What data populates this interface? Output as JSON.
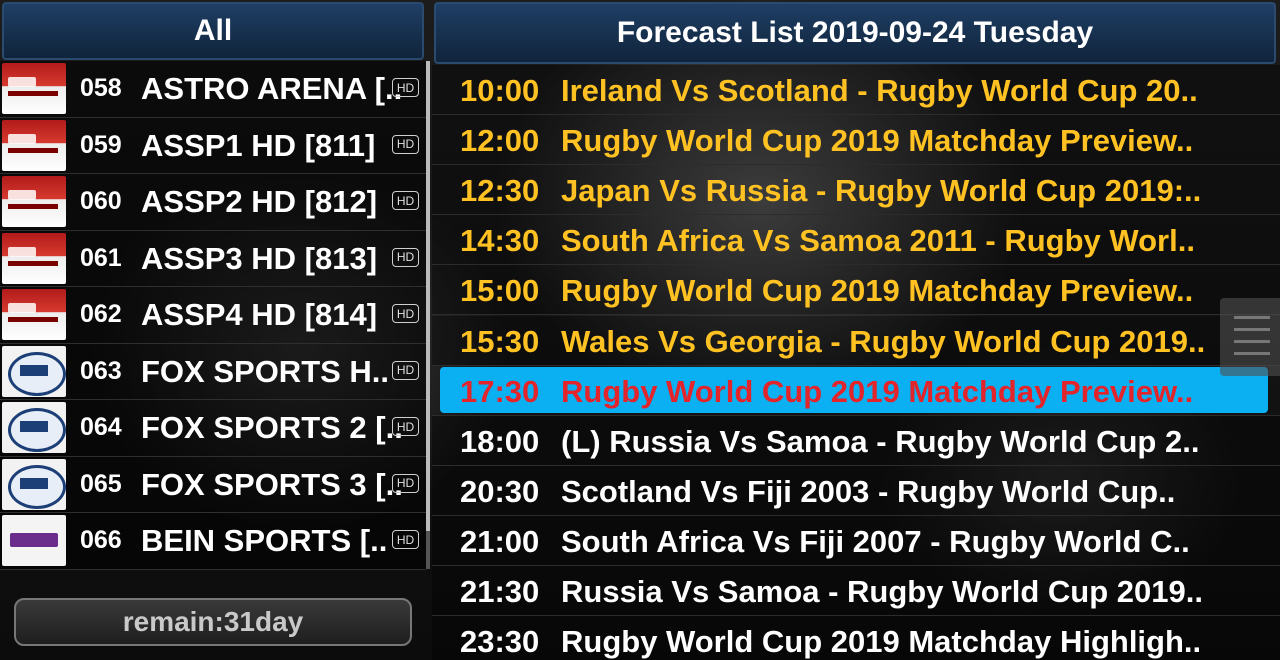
{
  "left_panel": {
    "title": "All",
    "channels": [
      {
        "num": "058",
        "name": "ASTRO ARENA [..",
        "badge": "HD",
        "logo": "astro-arena-logo"
      },
      {
        "num": "059",
        "name": "ASSP1 HD [811]",
        "badge": "HD",
        "logo": "astro-supersport-logo"
      },
      {
        "num": "060",
        "name": "ASSP2 HD [812]",
        "badge": "HD",
        "logo": "astro-supersport-logo"
      },
      {
        "num": "061",
        "name": "ASSP3 HD [813]",
        "badge": "HD",
        "logo": "astro-supersport-logo"
      },
      {
        "num": "062",
        "name": "ASSP4 HD [814]",
        "badge": "HD",
        "logo": "astro-supersport-logo"
      },
      {
        "num": "063",
        "name": "FOX SPORTS H..",
        "badge": "HD",
        "logo": "fox-sports-logo"
      },
      {
        "num": "064",
        "name": "FOX SPORTS 2 [..",
        "badge": "HD",
        "logo": "fox-sports-2-logo"
      },
      {
        "num": "065",
        "name": "FOX SPORTS 3 [..",
        "badge": "HD",
        "logo": "fox-sports-3-logo"
      },
      {
        "num": "066",
        "name": "BEIN SPORTS [..",
        "badge": "HD",
        "logo": "bein-sports-logo"
      }
    ],
    "remain": "remain:31day"
  },
  "right_panel": {
    "title": "Forecast List 2019-09-24 Tuesday",
    "programs": [
      {
        "time": "10:00",
        "title": "Ireland Vs Scotland - Rugby World Cup 20..",
        "state": "past"
      },
      {
        "time": "12:00",
        "title": "Rugby World Cup 2019 Matchday Preview..",
        "state": "past"
      },
      {
        "time": "12:30",
        "title": "Japan Vs Russia - Rugby World Cup 2019:..",
        "state": "past"
      },
      {
        "time": "14:30",
        "title": "South Africa Vs Samoa 2011 - Rugby Worl..",
        "state": "past"
      },
      {
        "time": "15:00",
        "title": "Rugby World Cup 2019 Matchday Preview..",
        "state": "past"
      },
      {
        "time": "15:30",
        "title": "Wales Vs Georgia - Rugby World Cup 2019..",
        "state": "past"
      },
      {
        "time": "17:30",
        "title": "Rugby World Cup 2019 Matchday Preview..",
        "state": "current"
      },
      {
        "time": "18:00",
        "title": "(L) Russia Vs Samoa - Rugby World Cup 2..",
        "state": "future"
      },
      {
        "time": "20:30",
        "title": "Scotland Vs Fiji 2003 - Rugby World Cup..",
        "state": "future"
      },
      {
        "time": "21:00",
        "title": "South Africa Vs Fiji 2007 - Rugby World C..",
        "state": "future"
      },
      {
        "time": "21:30",
        "title": "Russia Vs Samoa - Rugby World Cup 2019..",
        "state": "future"
      },
      {
        "time": "23:30",
        "title": "Rugby World Cup 2019 Matchday Highligh..",
        "state": "future"
      }
    ]
  },
  "colors": {
    "past_text": "#ffc222",
    "future_text": "#ffffff",
    "current_text": "#e3242b",
    "current_highlight": "#0ab0f2",
    "header_blue": "#17314f"
  }
}
